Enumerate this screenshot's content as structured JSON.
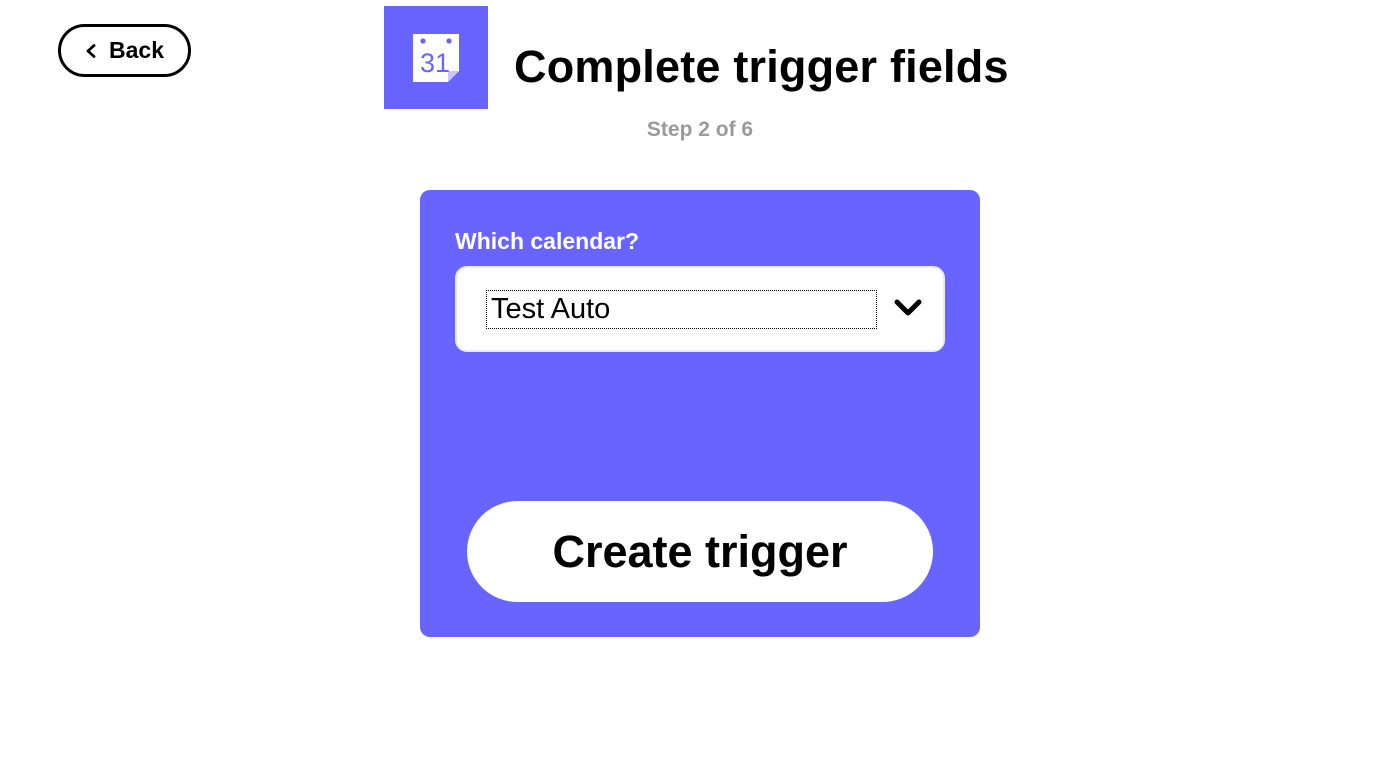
{
  "header": {
    "back_label": "Back",
    "title": "Complete trigger fields",
    "step": "Step 2 of 6",
    "service_icon": {
      "name": "calendar-icon",
      "day": "31"
    }
  },
  "form": {
    "field_label": "Which calendar?",
    "calendar_value": "Test Auto",
    "submit_label": "Create trigger"
  },
  "colors": {
    "accent": "#6864ff",
    "text": "#000000",
    "muted": "#9a9a9a",
    "surface": "#ffffff"
  },
  "icons": {
    "back": "chevron-left-icon",
    "dropdown": "chevron-down-icon"
  }
}
